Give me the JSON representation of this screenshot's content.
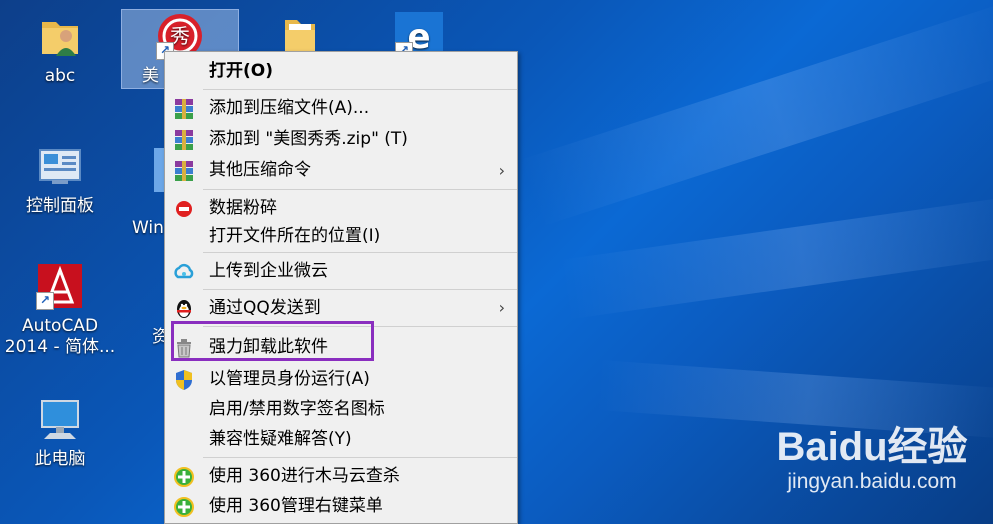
{
  "desktop": {
    "icons": [
      {
        "label": "abc",
        "icon": "folder-user-icon"
      },
      {
        "label": "美图秀秀",
        "visible_label": "美",
        "icon": "meitu-icon"
      },
      {
        "label": "",
        "icon": "folder-icon"
      },
      {
        "label": "",
        "icon": "edge-browser-icon"
      },
      {
        "label": "控制面板",
        "icon": "control-panel-icon"
      },
      {
        "label": "Win",
        "icon": "windows-app-icon"
      },
      {
        "label": "AutoCAD 2014 - 简体...",
        "icon": "autocad-icon"
      },
      {
        "label": "资",
        "icon": "resource-icon"
      },
      {
        "label": "此电脑",
        "icon": "computer-icon"
      }
    ],
    "accent_color": "#0b69d4"
  },
  "context_menu": {
    "items": [
      {
        "label": "打开(O)",
        "bold": true,
        "icon": "none",
        "submenu": false
      },
      {
        "label": "添加到压缩文件(A)...",
        "icon": "winrar-icon",
        "submenu": false
      },
      {
        "label": "添加到 \"美图秀秀.zip\" (T)",
        "icon": "winrar-icon",
        "submenu": false
      },
      {
        "label": "其他压缩命令",
        "icon": "winrar-icon",
        "submenu": true
      },
      {
        "label": "数据粉碎",
        "icon": "shred-icon",
        "submenu": false
      },
      {
        "label": "打开文件所在的位置(I)",
        "icon": "none",
        "submenu": false
      },
      {
        "label": "上传到企业微云",
        "icon": "weiyun-cloud-icon",
        "submenu": false
      },
      {
        "label": "通过QQ发送到",
        "icon": "qq-penguin-icon",
        "submenu": true
      },
      {
        "label": "强力卸载此软件",
        "icon": "trash-icon",
        "submenu": false
      },
      {
        "label": "以管理员身份运行(A)",
        "icon": "uac-shield-icon",
        "submenu": false
      },
      {
        "label": "启用/禁用数字签名图标",
        "icon": "none",
        "submenu": false
      },
      {
        "label": "兼容性疑难解答(Y)",
        "icon": "none",
        "submenu": false
      },
      {
        "label": "使用 360进行木马云查杀",
        "icon": "360-icon",
        "submenu": false
      },
      {
        "label": "使用 360管理右键菜单",
        "icon": "360-icon",
        "submenu": false
      }
    ],
    "submenu_glyph": "›",
    "highlight_color": "#8a2ebf"
  },
  "watermark": {
    "main": "Baidu经验",
    "url": "jingyan.baidu.com"
  }
}
